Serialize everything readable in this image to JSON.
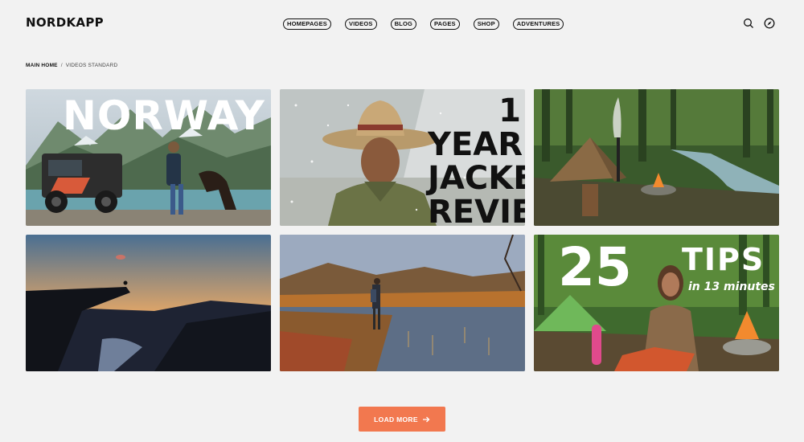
{
  "header": {
    "logo": "NORDKAPP",
    "nav": [
      "HOMEPAGES",
      "VIDEOS",
      "BLOG",
      "PAGES",
      "SHOP",
      "ADVENTURES"
    ],
    "icons": [
      "search-icon",
      "compass-icon"
    ]
  },
  "breadcrumb": {
    "home": "MAIN HOME",
    "separator": "/",
    "current": "VIDEOS STANDARD"
  },
  "videos": [
    {
      "title_text": "NORWAY"
    },
    {
      "title_line1": "1 YEAR",
      "title_line2": "JACKET",
      "title_line3": "REVIEW"
    },
    {},
    {},
    {},
    {
      "number": "25",
      "title": "TIPS",
      "subtitle": "in 13 minutes"
    }
  ],
  "load_more": {
    "label": "LOAD MORE",
    "icon": "arrow-right-icon",
    "color": "#f2784f"
  }
}
